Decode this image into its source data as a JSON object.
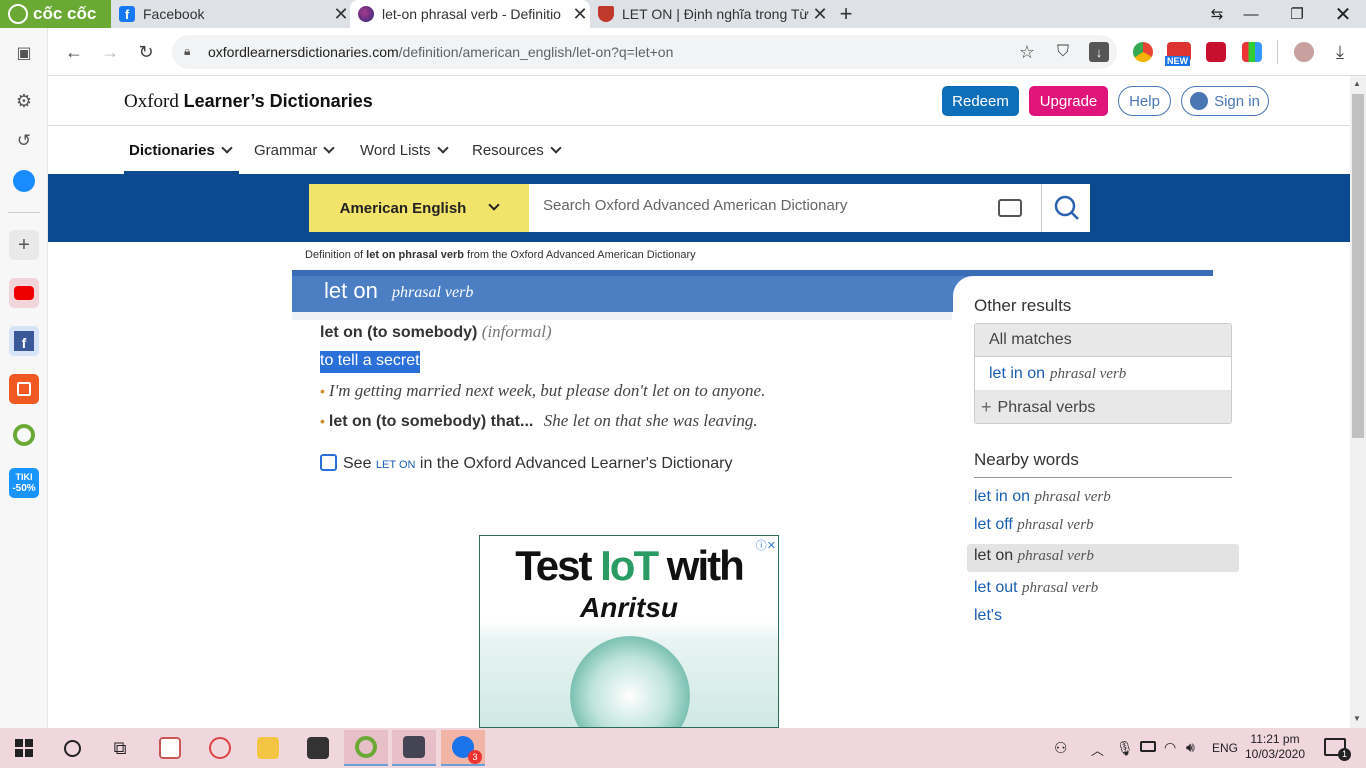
{
  "browser": {
    "brand": "cốc cốc",
    "tabs": [
      {
        "title": "Facebook",
        "icon": "facebook-icon"
      },
      {
        "title": "let-on phrasal verb - Definitio",
        "icon": "oxford-icon"
      },
      {
        "title": "LET ON | Định nghĩa trong Từ",
        "icon": "cambridge-icon"
      }
    ],
    "new_tab": "+",
    "url_host": "oxfordlearnersdictionaries.com",
    "url_path": "/definition/american_english/let-on?q=let+on",
    "ext_badge": "NEW"
  },
  "header": {
    "logo_plain": "Oxford ",
    "logo_bold": "Learner’s Dictionaries",
    "redeem": "Redeem",
    "upgrade": "Upgrade",
    "help": "Help",
    "signin": "Sign in"
  },
  "nav": {
    "items": [
      "Dictionaries",
      "Grammar",
      "Word Lists",
      "Resources"
    ]
  },
  "search": {
    "language": "American English",
    "placeholder": "Search Oxford Advanced American Dictionary"
  },
  "breadcrumb": {
    "pre": "Definition of ",
    "term": "let on phrasal verb",
    "post": " from the Oxford Advanced American Dictionary"
  },
  "entry": {
    "headword": "let on",
    "pos": "phrasal verb",
    "sense_phrase": "let on (to somebody)",
    "label": "(informal)",
    "definition": "to tell a secret",
    "example1": "I'm getting married next week, but please don't let on to anyone.",
    "example2_phrase": "let on (to somebody) that...",
    "example2": "She let on that she was leaving.",
    "see_pre": "See ",
    "see_word": "let on",
    "see_post": " in the Oxford Advanced Learner's Dictionary"
  },
  "ad": {
    "line1a": "Test ",
    "line1b": "IoT",
    "line1c": " with",
    "line2": "Anritsu"
  },
  "sidebar": {
    "other_results": "Other results",
    "all_matches": "All matches",
    "match1": "let in on",
    "match1_pos": "phrasal verb",
    "phrasal_verbs": "Phrasal verbs",
    "nearby_title": "Nearby words",
    "nearby": [
      {
        "word": "let in on",
        "pos": "phrasal verb"
      },
      {
        "word": "let off",
        "pos": "phrasal verb"
      },
      {
        "word": "let on",
        "pos": "phrasal verb"
      },
      {
        "word": "let out",
        "pos": "phrasal verb"
      },
      {
        "word": "let's",
        "pos": ""
      }
    ]
  },
  "taskbar": {
    "time": "11:21 pm",
    "date": "10/03/2020",
    "lang": "ENG",
    "zalo_badge": "3",
    "notif_badge": "1"
  },
  "left_sidebar": {
    "tiki_label": "TIKI",
    "tiki_discount": "-50%"
  },
  "colors": {
    "oxford_blue": "#0b4a91",
    "redeem": "#0d6fba",
    "upgrade": "#e0147a",
    "entry_head": "#4c7ec3",
    "coccoc_green": "#6aaa34"
  }
}
